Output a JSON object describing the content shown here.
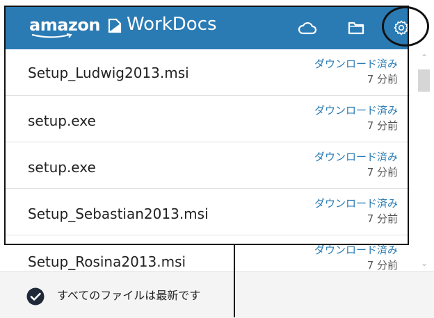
{
  "header": {
    "logo_amazon": "amazon",
    "logo_product": "WorkDocs",
    "background_color": "#2a7bb4",
    "icons": [
      "cloud-icon",
      "folder-icon",
      "gear-icon"
    ]
  },
  "files": [
    {
      "name": "Setup_Ludwig2013.msi",
      "status": "ダウンロード済み",
      "time": "7 分前"
    },
    {
      "name": "setup.exe",
      "status": "ダウンロード済み",
      "time": "7 分前"
    },
    {
      "name": "setup.exe",
      "status": "ダウンロード済み",
      "time": "7 分前"
    },
    {
      "name": "Setup_Sebastian2013.msi",
      "status": "ダウンロード済み",
      "time": "7 分前"
    },
    {
      "name": "Setup_Rosina2013.msi",
      "status": "ダウンロード済み",
      "time": "7 分前"
    }
  ],
  "footer": {
    "status_text": "すべてのファイルは最新です"
  },
  "colors": {
    "accent": "#2a7bb4",
    "status_text": "#2a7bb4"
  }
}
